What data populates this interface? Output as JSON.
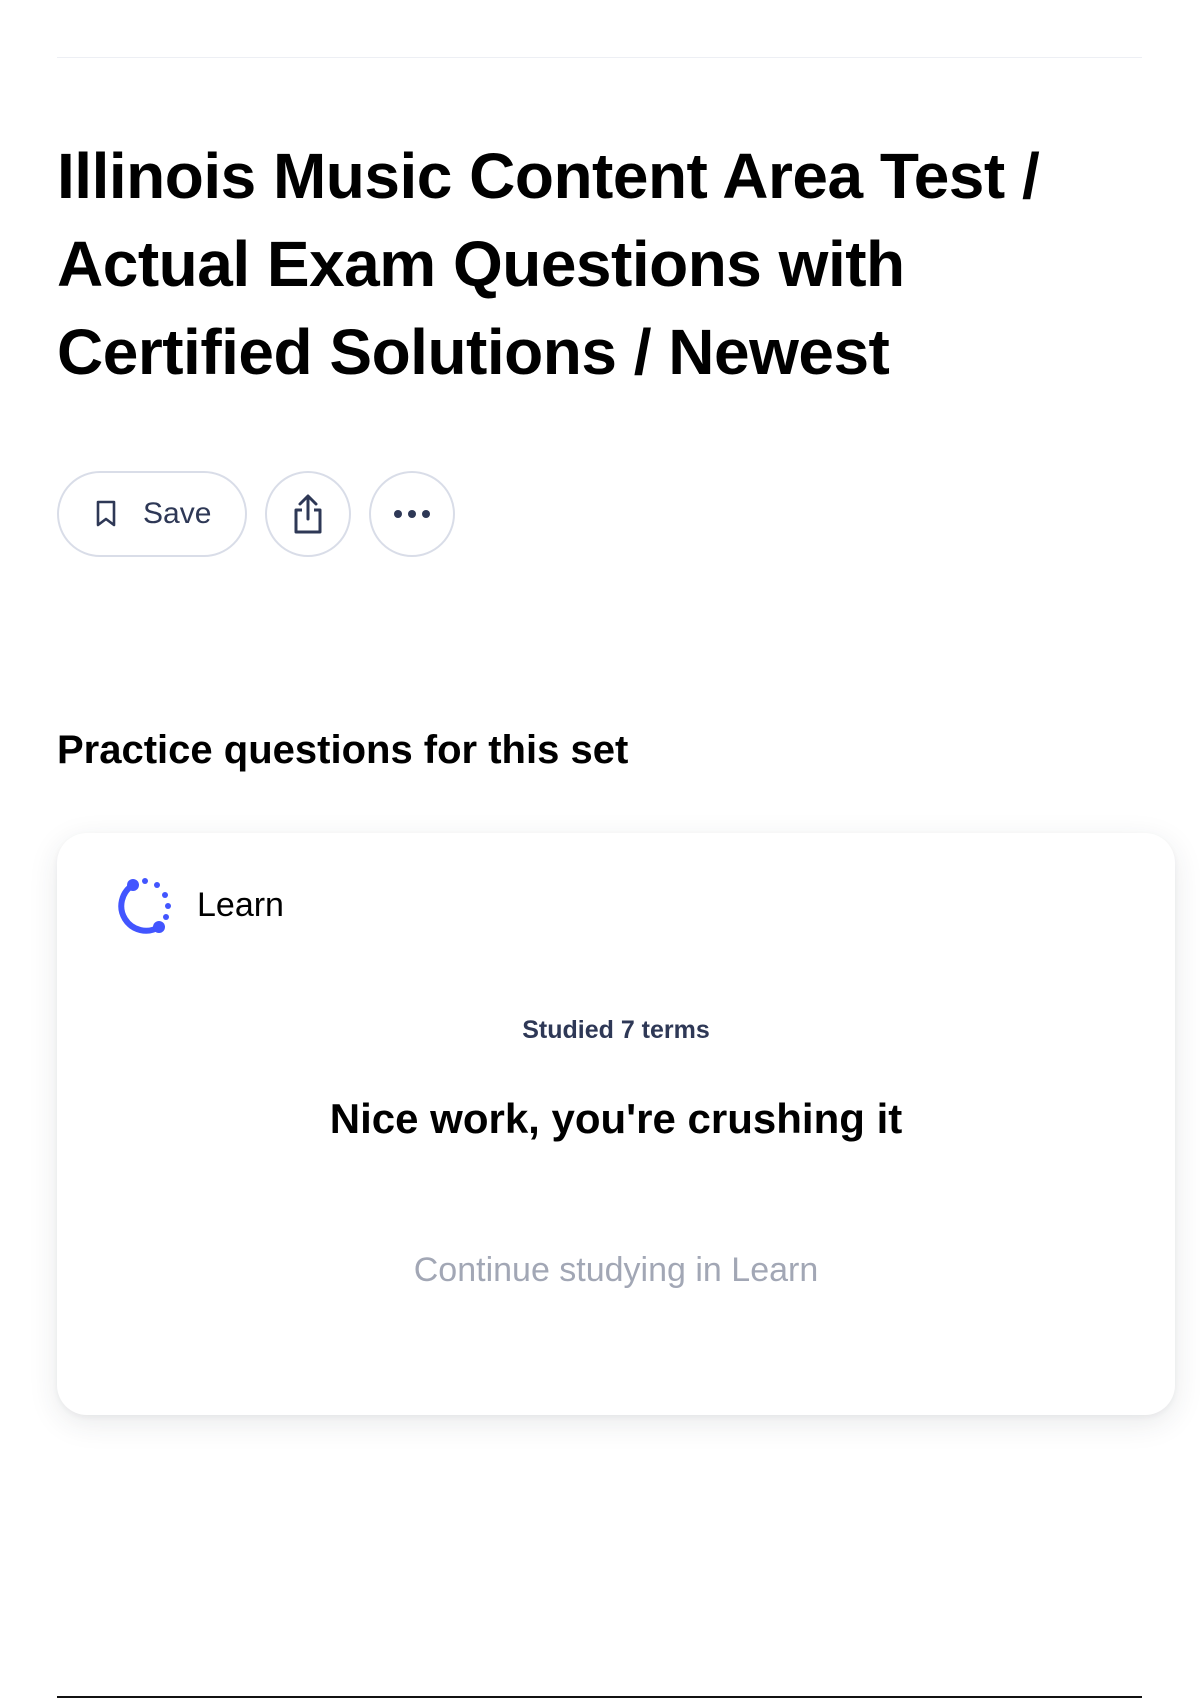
{
  "set": {
    "title": "Illinois Music Content Area Test / Actual Exam Questions with Certified Solutions / Newest"
  },
  "actions": {
    "save_label": "Save",
    "save_icon": "bookmark-icon",
    "share_icon": "share-icon",
    "more_icon": "more-icon"
  },
  "practice": {
    "heading": "Practice questions for this set",
    "card": {
      "mode_icon": "learn-icon",
      "mode_label": "Learn",
      "studied_text": "Studied 7 terms",
      "message": "Nice work, you're crushing it",
      "continue_label": "Continue studying in Learn"
    }
  },
  "colors": {
    "accent": "#4255ff",
    "text_primary": "#000000",
    "text_secondary": "#2e3856",
    "text_muted": "#a2a7b5",
    "border": "#d9dde8"
  }
}
